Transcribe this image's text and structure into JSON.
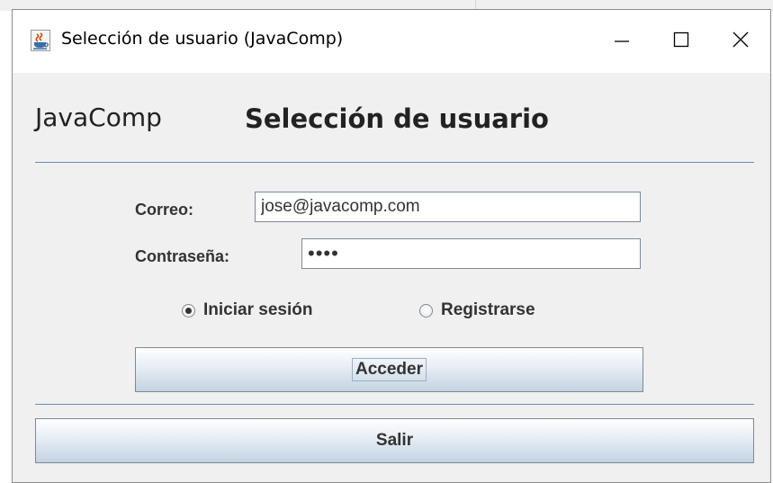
{
  "window": {
    "title": "Selección de usuario (JavaComp)",
    "minimize_glyph": "—",
    "maximize_glyph": "☐",
    "close_glyph": "✕"
  },
  "header": {
    "brand": "JavaComp",
    "title": "Selección de usuario"
  },
  "form": {
    "email_label": "Correo:",
    "email_value": "jose@javacomp.com",
    "password_label": "Contraseña:",
    "password_value": "••••",
    "mode_options": [
      {
        "label": "Iniciar sesión",
        "selected": true
      },
      {
        "label": "Registrarse",
        "selected": false
      }
    ],
    "submit_label": "Acceder"
  },
  "footer": {
    "exit_label": "Salir"
  },
  "icons": {
    "app": "java-cup-icon",
    "minimize": "minimize-icon",
    "maximize": "maximize-icon",
    "close": "close-icon",
    "radio_selected": "radio-selected-icon",
    "radio_unselected": "radio-unselected-icon"
  },
  "colors": {
    "separator": "#6d8ab8",
    "window_bg": "#f0f0f0",
    "titlebar_bg": "#ffffff"
  }
}
